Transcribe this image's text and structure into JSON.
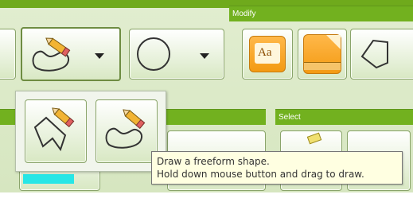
{
  "ribbon": {
    "groups": {
      "modify": {
        "label": "Modify"
      },
      "select": {
        "label": "Select"
      }
    },
    "text_button_glyph": "Aa"
  },
  "tooltip": {
    "line1": "Draw a freeform shape.",
    "line2": "Hold down mouse button and drag to draw."
  },
  "colors": {
    "ribbon_green": "#72b11f",
    "ribbon_bg": "#dde9ca",
    "fill_swatch": "#27e6e6",
    "accent_orange": "#f39a12"
  }
}
